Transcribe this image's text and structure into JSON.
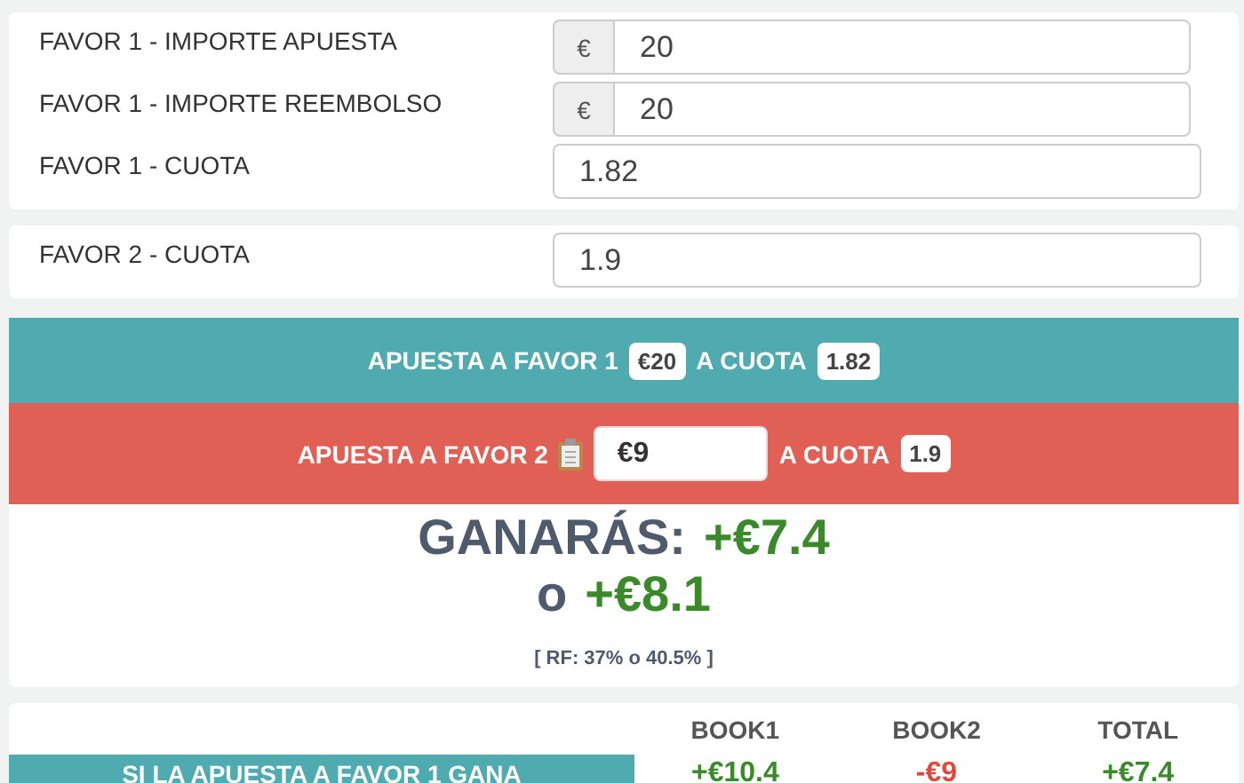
{
  "input_groups": [
    {
      "fields": [
        {
          "label": "FAVOR 1 - IMPORTE APUESTA",
          "kind": "currency",
          "prefix": "€",
          "value": "20"
        },
        {
          "label": "FAVOR 1 - IMPORTE REEMBOLSO",
          "kind": "currency",
          "prefix": "€",
          "value": "20"
        },
        {
          "label": "FAVOR 1 - CUOTA",
          "kind": "plain",
          "value": "1.82"
        }
      ]
    },
    {
      "fields": [
        {
          "label": "FAVOR 2 - CUOTA",
          "kind": "plain",
          "value": "1.9"
        }
      ]
    }
  ],
  "bets": [
    {
      "kind": "fixed",
      "label": "APUESTA A FAVOR 1",
      "amount": "€20",
      "odds_label": "A CUOTA",
      "odds": "1.82"
    },
    {
      "kind": "editable",
      "label": "APUESTA A FAVOR 2",
      "amount": "€9",
      "odds_label": "A CUOTA",
      "odds": "1.9"
    }
  ],
  "result": {
    "heading": "GANARÁS:",
    "profit_1": "+€7.4",
    "separator": "o",
    "profit_2": "+€8.1",
    "rf": "[ RF: 37% o 40.5% ]"
  },
  "table": {
    "columns": [
      "BOOK1",
      "BOOK2",
      "TOTAL"
    ],
    "rows": [
      {
        "label": "SI LA APUESTA A FAVOR 1 GANA",
        "cells": [
          {
            "value": "+€10.4",
            "color": "#3a8a2a"
          },
          {
            "value": "-€9",
            "color": "#e04a3a"
          },
          {
            "value": "+€7.4",
            "color": "#3a8a2a"
          }
        ]
      }
    ]
  }
}
